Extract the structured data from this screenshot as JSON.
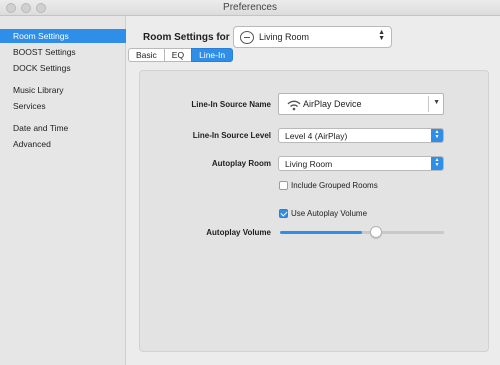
{
  "window": {
    "title": "Preferences"
  },
  "sidebar": {
    "items": [
      {
        "label": "Room Settings",
        "active": true
      },
      {
        "label": "BOOST Settings"
      },
      {
        "label": "DOCK Settings"
      },
      {
        "label": "Music Library"
      },
      {
        "label": "Services"
      },
      {
        "label": "Date and Time"
      },
      {
        "label": "Advanced"
      }
    ]
  },
  "header": {
    "label": "Room Settings for",
    "room_value": "Living Room"
  },
  "tabs": [
    {
      "label": "Basic"
    },
    {
      "label": "EQ"
    },
    {
      "label": "Line-In",
      "active": true
    }
  ],
  "form": {
    "source_name_label": "Line-In Source Name",
    "source_name_value": "AirPlay Device",
    "source_level_label": "Line-In Source Level",
    "source_level_value": "Level 4 (AirPlay)",
    "autoplay_room_label": "Autoplay Room",
    "autoplay_room_value": "Living Room",
    "include_grouped_label": "Include Grouped Rooms",
    "include_grouped_checked": false,
    "use_autoplay_volume_label": "Use Autoplay Volume",
    "use_autoplay_volume_checked": true,
    "autoplay_volume_label": "Autoplay Volume",
    "autoplay_volume_fraction": 0.5
  },
  "colors": {
    "accent": "#2f8ee8"
  }
}
